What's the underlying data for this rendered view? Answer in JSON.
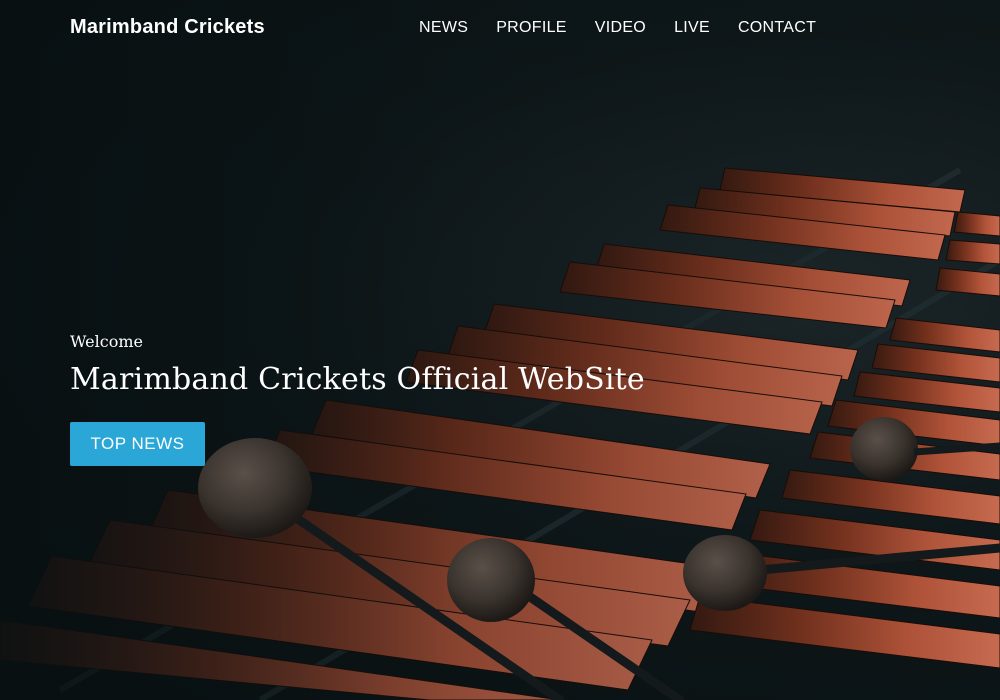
{
  "site": {
    "brand": "Marimband Crickets"
  },
  "nav": {
    "items": [
      {
        "label": "NEWS"
      },
      {
        "label": "PROFILE"
      },
      {
        "label": "VIDEO"
      },
      {
        "label": "LIVE"
      },
      {
        "label": "CONTACT"
      }
    ]
  },
  "hero": {
    "eyebrow": "Welcome",
    "headline": "Marimband Crickets Official WebSite",
    "cta_label": "TOP NEWS",
    "image": "marimba-photo"
  },
  "colors": {
    "background": "#0c1416",
    "accent": "#2aa7d6",
    "bar_wood": "#8a3a22",
    "text": "#ffffff"
  }
}
